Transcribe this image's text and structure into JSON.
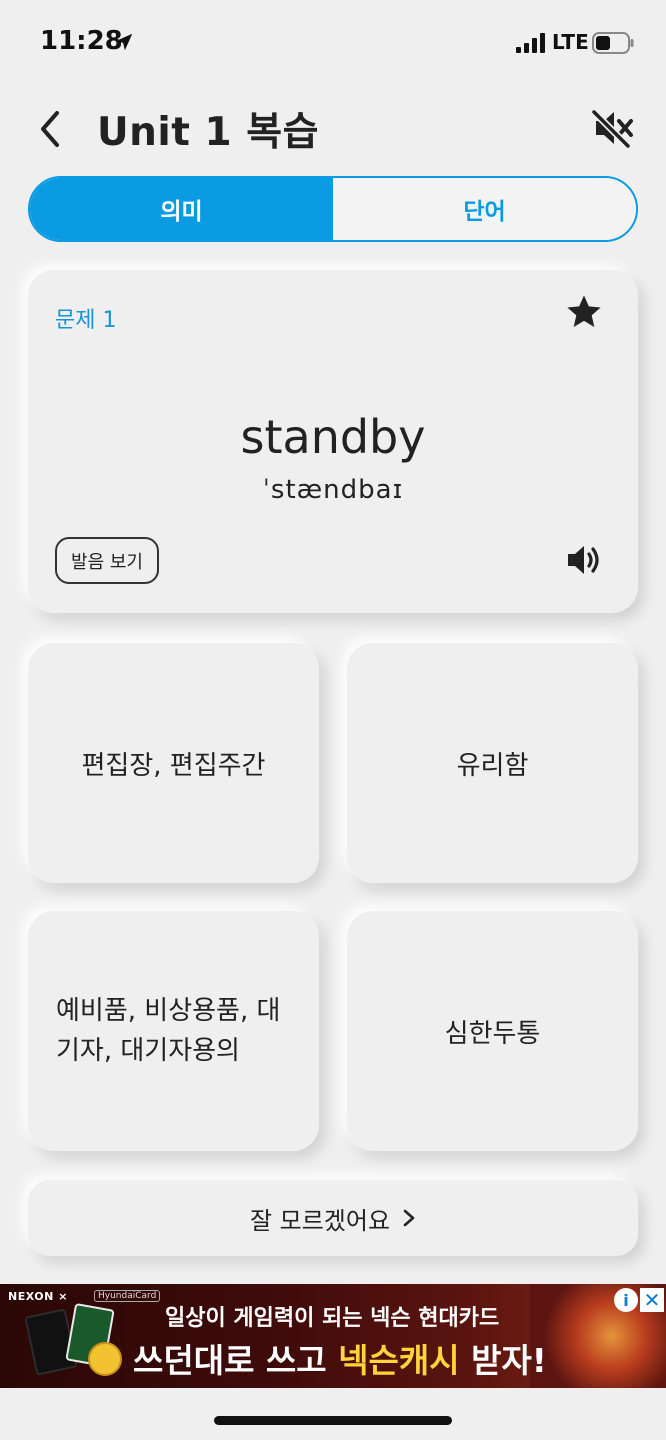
{
  "status_bar": {
    "time": "11:28",
    "network": "LTE"
  },
  "header": {
    "title": "Unit 1 복습"
  },
  "tabs": [
    {
      "label": "의미",
      "active": true
    },
    {
      "label": "단어",
      "active": false
    }
  ],
  "question": {
    "number_label": "문제 1",
    "word": "standby",
    "phonetic": "ˈstændbaɪ",
    "pronunciation_button": "발음 보기",
    "starred": true
  },
  "answers": {
    "a1": "편집장, 편집주간",
    "a2": "유리함",
    "a3_line1": "예비품, 비상용품, 대",
    "a3_line2": "기자, 대기자용의",
    "a4": "심한두통"
  },
  "skip_label": "잘 모르겠어요",
  "ad": {
    "brand": "NEXON",
    "brand_x": "×",
    "partner": "HyundaiCard",
    "line1": "일상이 게임력이 되는 넥슨 현대카드",
    "line2_a": "쓰던대로 쓰고 ",
    "line2_b": "넥슨캐시",
    "line2_c": " 받자!",
    "info": "i",
    "close": "✕"
  },
  "colors": {
    "accent": "#0a9be3",
    "background": "#efefef",
    "question_number": "#1a93d6"
  }
}
